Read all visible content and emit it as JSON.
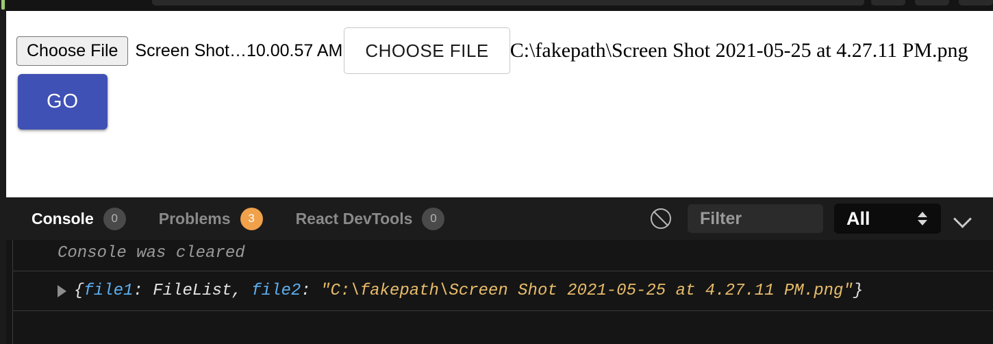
{
  "browser_toolbar": {
    "url_bar_placeholder": "",
    "buttons": [
      "",
      "",
      ""
    ]
  },
  "page": {
    "native_file_input": {
      "button_label": "Choose File",
      "selected_file_text": "Screen Shot…10.00.57 AM"
    },
    "custom_file_button": {
      "label": "CHOOSE FILE"
    },
    "path_text": "C:\\fakepath\\Screen Shot 2021-05-25 at 4.27.11 PM.png",
    "go_button": {
      "label": "GO",
      "color": "#3f51b5"
    }
  },
  "console_panel": {
    "tabs": [
      {
        "label": "Console",
        "badge": "0",
        "active": true,
        "badge_color": "#4a4a4a"
      },
      {
        "label": "Problems",
        "badge": "3",
        "active": false,
        "badge_color": "#f0a14a"
      },
      {
        "label": "React DevTools",
        "badge": "0",
        "active": false,
        "badge_color": "#4a4a4a"
      }
    ],
    "clear_icon": "circle-slash-icon",
    "filter": {
      "placeholder": "Filter",
      "value": ""
    },
    "level_select": {
      "selected": "All",
      "options": [
        "All"
      ]
    },
    "expand_chevron": "chevron-down-icon",
    "logs": [
      {
        "type": "cleared-notice",
        "text": "Console was cleared"
      },
      {
        "type": "object",
        "disclosure": "collapsed",
        "open_brace": "{",
        "key1": "file1",
        "sep1": ": ",
        "value1": "FileList",
        "comma": ", ",
        "key2": "file2",
        "sep2": ": ",
        "value2": "\"C:\\fakepath\\Screen Shot 2021-05-25 at 4.27.11 PM.png\"",
        "close_brace": "}"
      }
    ]
  }
}
